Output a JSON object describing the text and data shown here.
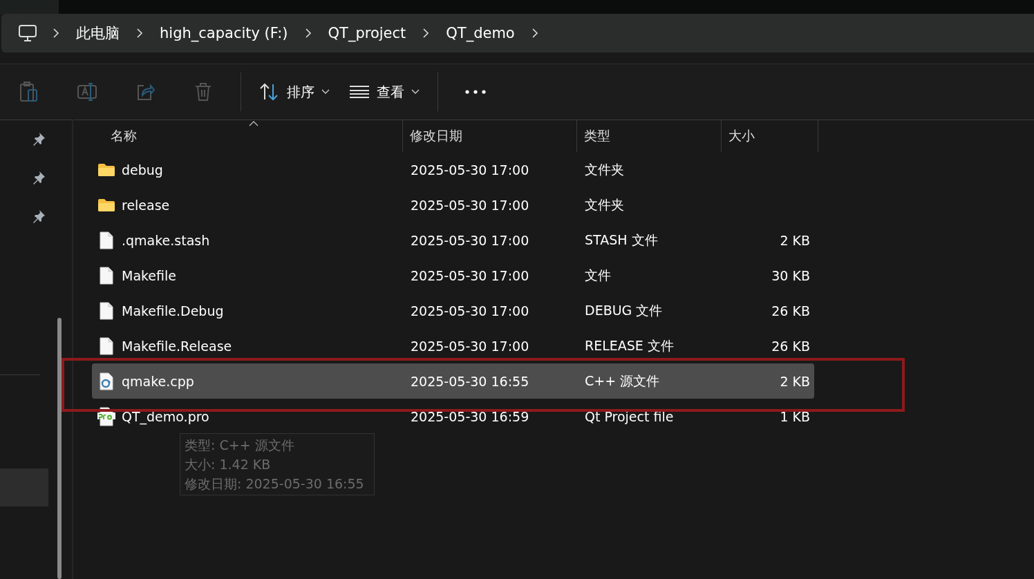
{
  "breadcrumb": [
    {
      "label": "此电脑"
    },
    {
      "label": "high_capacity (F:)"
    },
    {
      "label": "QT_project"
    },
    {
      "label": "QT_demo"
    }
  ],
  "toolbar": {
    "sort_label": "排序",
    "view_label": "查看"
  },
  "columns": [
    {
      "label": "名称",
      "sorted": true
    },
    {
      "label": "修改日期",
      "sorted": false
    },
    {
      "label": "类型",
      "sorted": false
    },
    {
      "label": "大小",
      "sorted": false
    }
  ],
  "rows": [
    {
      "kind": "folder",
      "name": "debug",
      "modified": "2025-05-30 17:00",
      "type": "文件夹",
      "selected": false
    },
    {
      "kind": "folder",
      "name": "release",
      "modified": "2025-05-30 17:00",
      "type": "文件夹",
      "selected": false
    },
    {
      "kind": "file",
      "name": ".qmake.stash",
      "modified": "2025-05-30 17:00",
      "type": "STASH 文件",
      "size": "2 KB",
      "selected": false
    },
    {
      "kind": "file",
      "name": "Makefile",
      "modified": "2025-05-30 17:00",
      "type": "文件",
      "size": "30 KB",
      "selected": false
    },
    {
      "kind": "file",
      "name": "Makefile.Debug",
      "modified": "2025-05-30 17:00",
      "type": "DEBUG 文件",
      "size": "26 KB",
      "selected": false
    },
    {
      "kind": "file",
      "name": "Makefile.Release",
      "modified": "2025-05-30 17:00",
      "type": "RELEASE 文件",
      "size": "26 KB",
      "selected": false
    },
    {
      "kind": "cpp",
      "name": "qmake.cpp",
      "modified": "2025-05-30 16:55",
      "type": "C++ 源文件",
      "size": "2 KB",
      "selected": true
    },
    {
      "kind": "pro",
      "name": "QT_demo.pro",
      "modified": "2025-05-30 16:59",
      "type": "Qt Project file",
      "size": "1 KB",
      "selected": false
    }
  ],
  "tooltip": {
    "lines": [
      "类型: C++ 源文件",
      "大小: 1.42 KB",
      "修改日期: 2025-05-30 16:55"
    ]
  }
}
